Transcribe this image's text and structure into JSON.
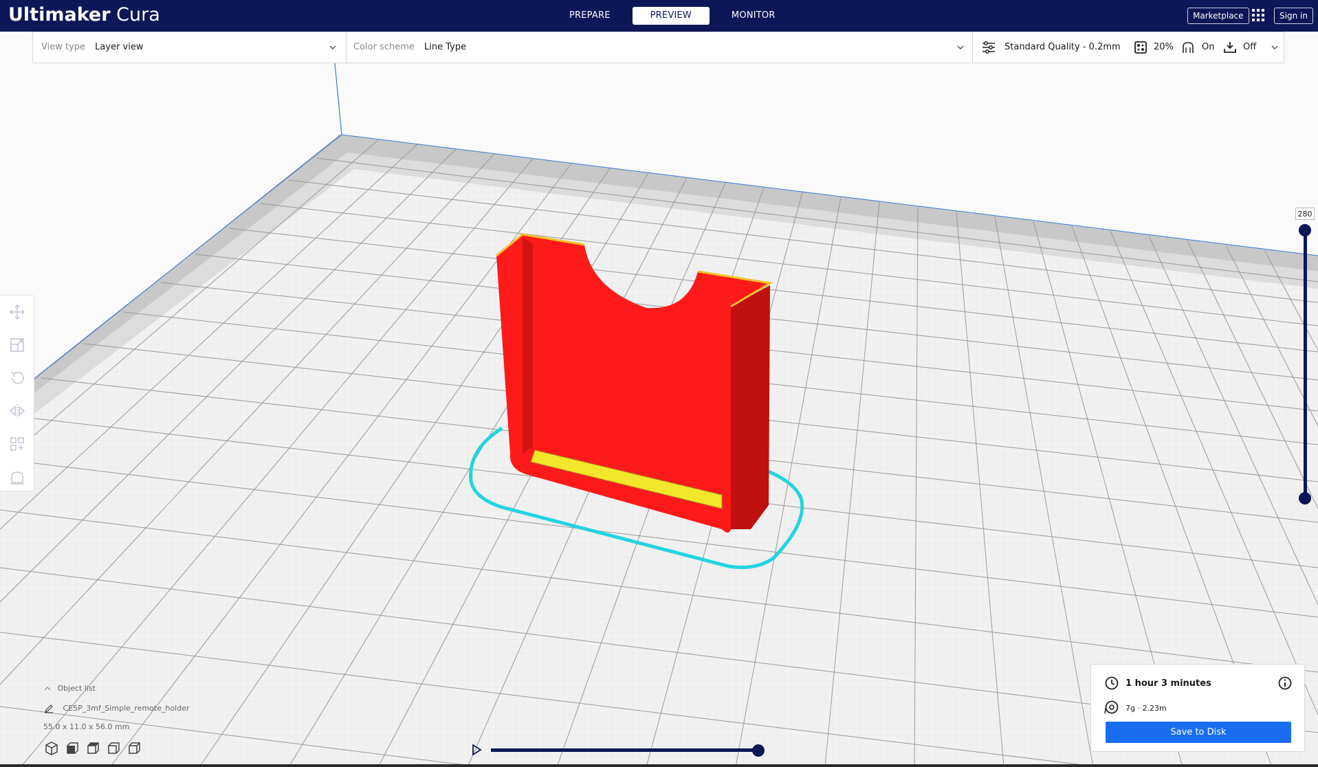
{
  "app": {
    "brand_bold": "Ultimaker",
    "brand_light": " Cura"
  },
  "stages": [
    {
      "label": "PREPARE",
      "active": false
    },
    {
      "label": "PREVIEW",
      "active": true
    },
    {
      "label": "MONITOR",
      "active": false
    }
  ],
  "header": {
    "marketplace_label": "Marketplace",
    "signin_label": "Sign in",
    "apps_icon": "apps-grid-icon"
  },
  "view_settings": {
    "view_type_label": "View type",
    "view_type_value": "Layer view",
    "color_scheme_label": "Color scheme",
    "color_scheme_value": "Line Type"
  },
  "print_setup": {
    "profile": "Standard Quality - 0.2mm",
    "infill": "20%",
    "support": "On",
    "adhesion": "Off"
  },
  "toolbar": {
    "tools": [
      "move-icon",
      "scale-icon",
      "rotate-icon",
      "mirror-icon",
      "per-model-settings-icon",
      "support-blocker-icon"
    ]
  },
  "layer_slider": {
    "current_layer": "280",
    "position": 1.0
  },
  "object_info": {
    "list_label": "Object list",
    "object_name": "CE5P_3mf_Simple_remote_holder",
    "dimensions": "55.0 x 11.0 x 56.0 mm"
  },
  "view_icons": [
    "3d-view-icon",
    "front-view-icon",
    "top-view-icon",
    "left-view-icon",
    "right-view-icon"
  ],
  "timeline": {
    "position": 1.0
  },
  "print_info": {
    "time": "1 hour 3 minutes",
    "material": "7g · 2.23m",
    "save_label": "Save to Disk"
  },
  "colors": {
    "header_bg": "#0c1758",
    "accent_blue": "#196ef0",
    "model_wall": "#ff1a1a",
    "model_top": "#f2e72a",
    "skirt": "#22d4e0"
  }
}
